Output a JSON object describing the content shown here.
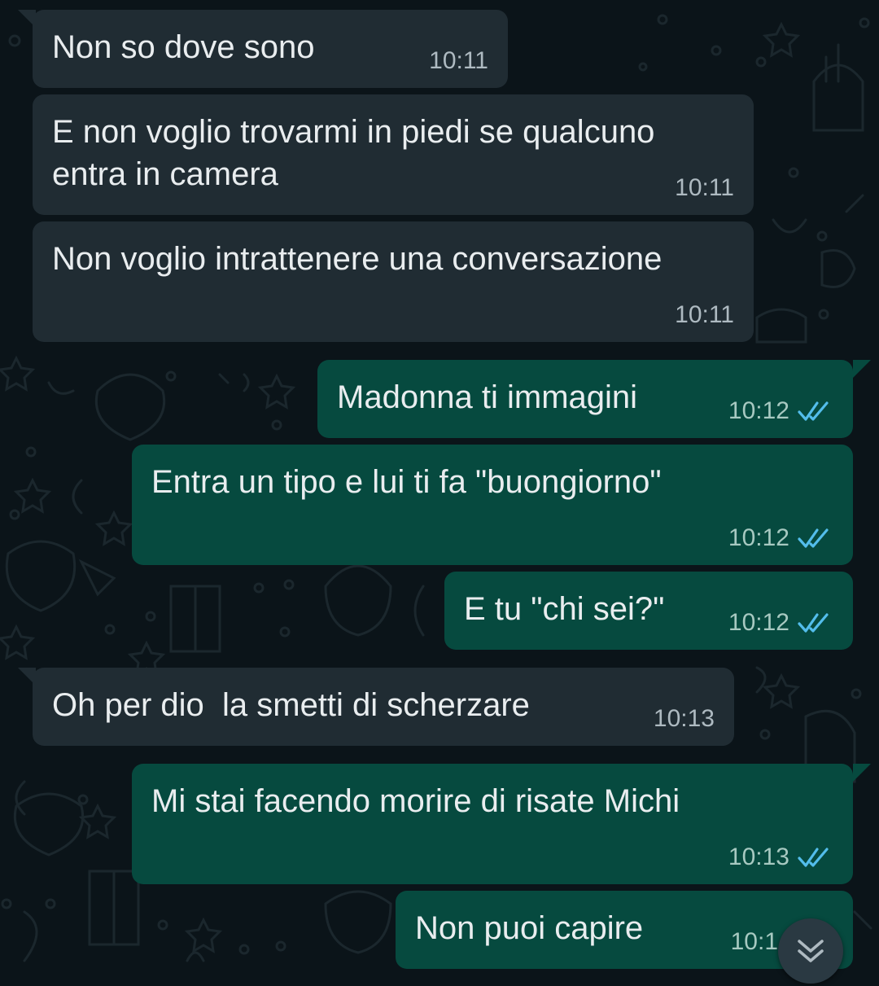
{
  "colors": {
    "background": "#0b1419",
    "incoming_bubble": "#202c33",
    "outgoing_bubble": "#064a3f",
    "text": "#e9edef",
    "read_tick": "#53bdeb"
  },
  "messages": [
    {
      "direction": "incoming",
      "text": "Non so dove sono",
      "time": "10:11"
    },
    {
      "direction": "incoming",
      "text": "E non voglio trovarmi in piedi se qualcuno\nentra in camera",
      "time": "10:11"
    },
    {
      "direction": "incoming",
      "text": "Non voglio intrattenere una conversazione",
      "time": "10:11"
    },
    {
      "direction": "outgoing",
      "text": "Madonna ti immagini",
      "time": "10:12",
      "status": "read"
    },
    {
      "direction": "outgoing",
      "text": "Entra un tipo e lui ti fa \"buongiorno\"",
      "time": "10:12",
      "status": "read"
    },
    {
      "direction": "outgoing",
      "text": "E tu \"chi sei?\"",
      "time": "10:12",
      "status": "read"
    },
    {
      "direction": "incoming",
      "text": "Oh per dio  la smetti di scherzare",
      "time": "10:13"
    },
    {
      "direction": "outgoing",
      "text": "Mi stai facendo morire di risate Michi",
      "time": "10:13",
      "status": "read"
    },
    {
      "direction": "outgoing",
      "text": "Non puoi capire",
      "time": "10:1",
      "status": "read"
    }
  ],
  "scroll_down_button": {
    "icon": "double-chevron-down-icon"
  }
}
